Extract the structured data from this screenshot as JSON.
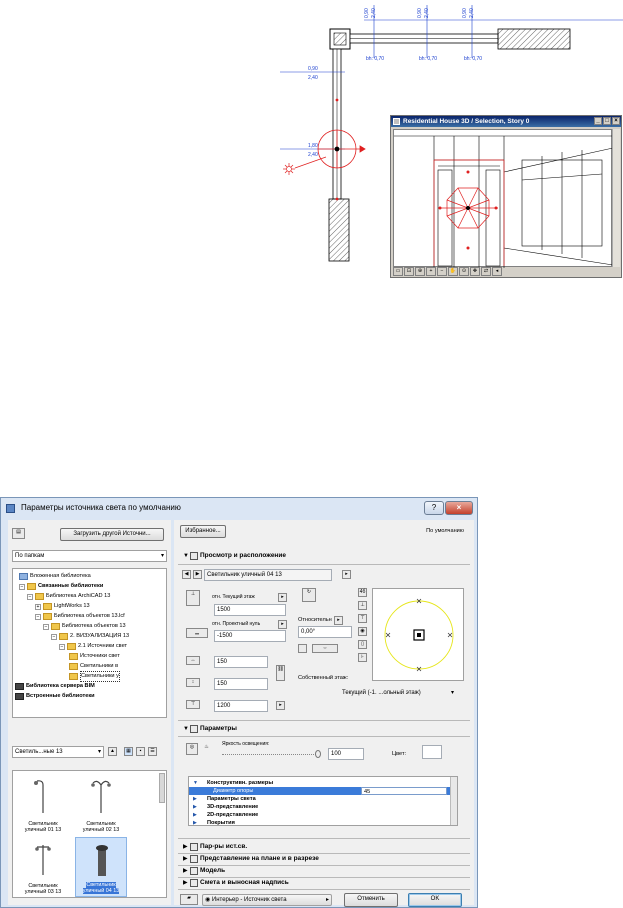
{
  "plan": {
    "dims_top": [
      {
        "line1": "0,90",
        "line2": "2,40"
      },
      {
        "line1": "0,90",
        "line2": "2,40"
      },
      {
        "line1": "0,90",
        "line2": "2,40"
      }
    ],
    "bh_labels": [
      "bh: 0,70",
      "bh: 0,70",
      "bh: 0,70"
    ],
    "dim_left_1": {
      "line1": "0,90",
      "line2": "2,40"
    },
    "dim_left_2": {
      "line1": "1,80",
      "line2": "2,40"
    }
  },
  "window3d": {
    "title": "Residential House 3D / Selection, Story 0",
    "buttons": [
      "_",
      "□",
      "×"
    ]
  },
  "dialog": {
    "title": "Параметры источника света по умолчанию",
    "help_btn": "?",
    "close_btn": "×",
    "left": {
      "load_btn": "Загрузить другой Источни...",
      "view_mode": "По папкам",
      "tree": [
        {
          "label": "Вложенная библиотека",
          "bold": false
        },
        {
          "label": "Связанные библиотеки",
          "bold": true
        },
        {
          "label": "Библиотека ArchiCAD 13",
          "bold": false
        },
        {
          "label": "LightWorks 13",
          "bold": false
        },
        {
          "label": "Библиотека объектов 13.lcf",
          "bold": false
        },
        {
          "label": "Библиотека объектов 13",
          "bold": false
        },
        {
          "label": "2. ВИЗУАЛИЗАЦИЯ 13",
          "bold": false
        },
        {
          "label": "2.1 Источники свет",
          "bold": false
        },
        {
          "label": "Источники свет",
          "bold": false
        },
        {
          "label": "Светильники в",
          "bold": false
        },
        {
          "label": "Светильники у",
          "bold": false
        },
        {
          "label": "Библиотека сервера BIM",
          "bold": true
        },
        {
          "label": "Встроенные библиотеки",
          "bold": true
        }
      ],
      "folder_select": "Светиль...ные 13",
      "objects": [
        {
          "label1": "Светильник",
          "label2": "уличный 01 13"
        },
        {
          "label1": "Светильник",
          "label2": "уличный 02 13"
        },
        {
          "label1": "Светильник",
          "label2": "уличный 03 13"
        },
        {
          "label1": "Светильник",
          "label2": "уличный 04 13"
        }
      ]
    },
    "right": {
      "favorites_btn": "Избранное...",
      "default_label": "По умолчанию",
      "section_preview": "Просмотр и расположение",
      "object_name": "Светильник уличный 04 13",
      "rel_story_label": "отн. Текущий этаж",
      "height_value": "1500",
      "rel_zero_label": "отн. Проектный нуль",
      "elevation_value": "-1500",
      "width_value": "150",
      "depth_value": "150",
      "height2_value": "1200",
      "relative_label": "Относительн",
      "angle_value": "0,00°",
      "own_story_label": "Собственный этаж:",
      "story_select": "Текущий (-1. ...ольный этаж)",
      "section_params": "Параметры",
      "brightness_label": "Яркость освещения:",
      "brightness_value": "100",
      "color_label": "Цвет:",
      "param_rows": [
        {
          "label": "Конструктивн. размеры",
          "expanded": true
        },
        {
          "label": "Диаметр опоры",
          "value": "45",
          "selected": true
        },
        {
          "label": "Параметры света",
          "expanded": false
        },
        {
          "label": "3D-представление",
          "expanded": false
        },
        {
          "label": "2D-представление",
          "expanded": false
        },
        {
          "label": "Покрытия",
          "expanded": false
        }
      ],
      "sections_collapsed": [
        "Пар-ры ист.св.",
        "Представление на плане и в разрезе",
        "Модель",
        "Смета и выносная надпись"
      ],
      "layer_select": "Интерьер - Источник света",
      "cancel_btn": "Отменить",
      "ok_btn": "OK"
    }
  },
  "colors": {
    "dim_blue": "#1a3ecf",
    "light_red": "#e02020",
    "dialog_bg": "#dbe6f4",
    "selection_blue": "#3b7bd9"
  }
}
